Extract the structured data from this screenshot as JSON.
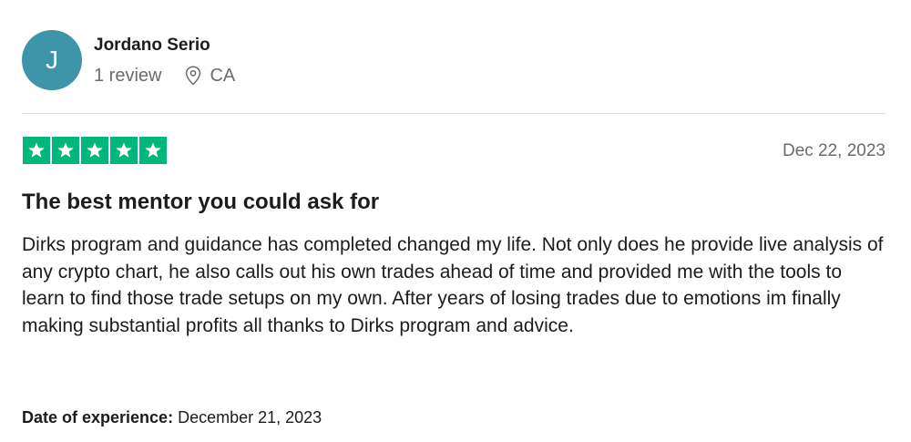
{
  "reviewer": {
    "avatar_letter": "J",
    "avatar_color": "#3e94a8",
    "name": "Jordano Serio",
    "review_count": "1 review",
    "location": "CA"
  },
  "rating": {
    "stars": 5,
    "max_stars": 5,
    "star_color": "#00b67a"
  },
  "review": {
    "date": "Dec 22, 2023",
    "title": "The best mentor you could ask for",
    "body": "Dirks program and guidance has completed changed my life. Not only does he provide live analysis of any crypto chart, he also calls out his own trades ahead of time and provided me with the tools to learn to find those trade setups on my own. After years of losing trades due to emotions im finally making substantial profits all thanks to Dirks program and advice.",
    "experience_label": "Date of experience:",
    "experience_date": "December 21, 2023"
  },
  "icons": {
    "location": "map-pin-icon",
    "star": "star-icon"
  }
}
